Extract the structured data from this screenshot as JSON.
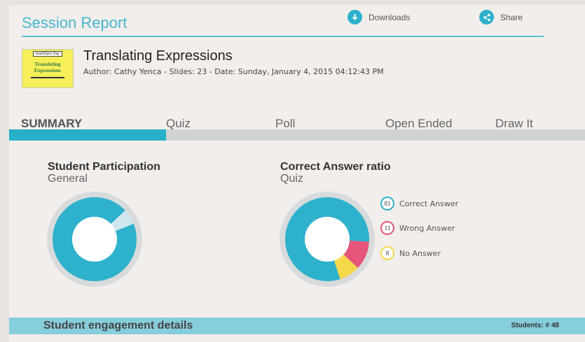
{
  "header": {
    "title": "Session Report",
    "downloads_label": "Downloads",
    "share_label": "Share"
  },
  "presentation": {
    "thumb_top": "teachSync Day",
    "thumb_title_line1": "Translating",
    "thumb_title_line2": "Expressions",
    "title": "Translating Expressions",
    "meta": "Author: Cathy Yenca - Slides: 23 - Date: Sunday, January 4, 2015 04:12:43 PM"
  },
  "tabs": [
    {
      "label": "SUMMARY",
      "active": true
    },
    {
      "label": "Quiz"
    },
    {
      "label": "Poll"
    },
    {
      "label": "Open Ended"
    },
    {
      "label": "Draw It"
    }
  ],
  "participation": {
    "title": "Student Participation",
    "subtitle": "General"
  },
  "correct_ratio": {
    "title": "Correct Answer ratio",
    "subtitle": "Quiz",
    "legend": [
      {
        "value": "81",
        "label": "Correct Answer",
        "color": "#2eb1cc"
      },
      {
        "value": "11",
        "label": "Wrong Answer",
        "color": "#e6557a"
      },
      {
        "value": "8",
        "label": "No Answer",
        "color": "#f6d84a"
      }
    ]
  },
  "chart_data": [
    {
      "type": "pie",
      "title": "Student Participation",
      "subtitle": "General",
      "categories": [
        "",
        ""
      ],
      "values": [
        94,
        6
      ],
      "colors": [
        "#2eb1cc",
        "#cfe8ee"
      ]
    },
    {
      "type": "pie",
      "title": "Correct Answer ratio",
      "subtitle": "Quiz",
      "categories": [
        "Correct Answer",
        "Wrong Answer",
        "No Answer"
      ],
      "values": [
        81,
        11,
        8
      ],
      "colors": [
        "#2eb1cc",
        "#e6557a",
        "#f6d84a"
      ]
    }
  ],
  "footer": {
    "title": "Student engagement details",
    "students": "Students: # 48"
  }
}
